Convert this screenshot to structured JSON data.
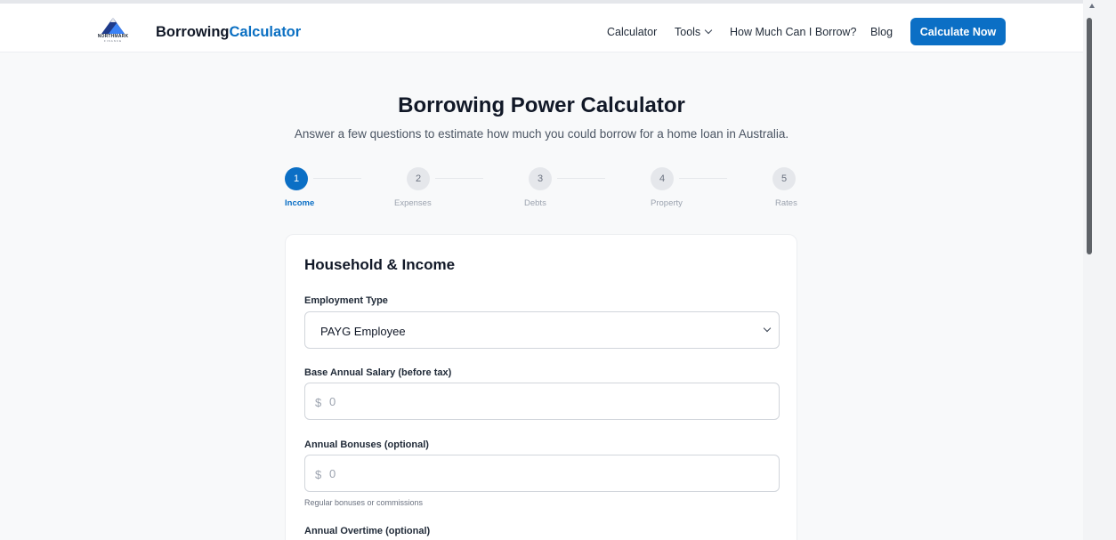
{
  "header": {
    "logo_text": "NORTHMARK",
    "logo_subtext": "FINANCE",
    "brand_part1": "Borrowing",
    "brand_part2": "Calculator",
    "nav": {
      "calculator": "Calculator",
      "tools": "Tools",
      "how_much": "How Much Can I Borrow?",
      "blog": "Blog"
    },
    "cta_label": "Calculate Now"
  },
  "hero": {
    "title": "Borrowing Power Calculator",
    "subtitle": "Answer a few questions to estimate how much you could borrow for a home loan in Australia."
  },
  "steps": [
    {
      "num": "1",
      "label": "Income",
      "active": true
    },
    {
      "num": "2",
      "label": "Expenses",
      "active": false
    },
    {
      "num": "3",
      "label": "Debts",
      "active": false
    },
    {
      "num": "4",
      "label": "Property",
      "active": false
    },
    {
      "num": "5",
      "label": "Rates",
      "active": false
    }
  ],
  "form": {
    "title": "Household & Income",
    "employment_type": {
      "label": "Employment Type",
      "value": "PAYG Employee"
    },
    "base_salary": {
      "label": "Base Annual Salary (before tax)",
      "prefix": "$",
      "placeholder": "0"
    },
    "bonuses": {
      "label": "Annual Bonuses (optional)",
      "prefix": "$",
      "placeholder": "0",
      "helper": "Regular bonuses or commissions"
    },
    "overtime": {
      "label": "Annual Overtime (optional)"
    }
  },
  "colors": {
    "accent": "#0b6fc5",
    "background": "#f8f9fa",
    "card": "#ffffff"
  }
}
